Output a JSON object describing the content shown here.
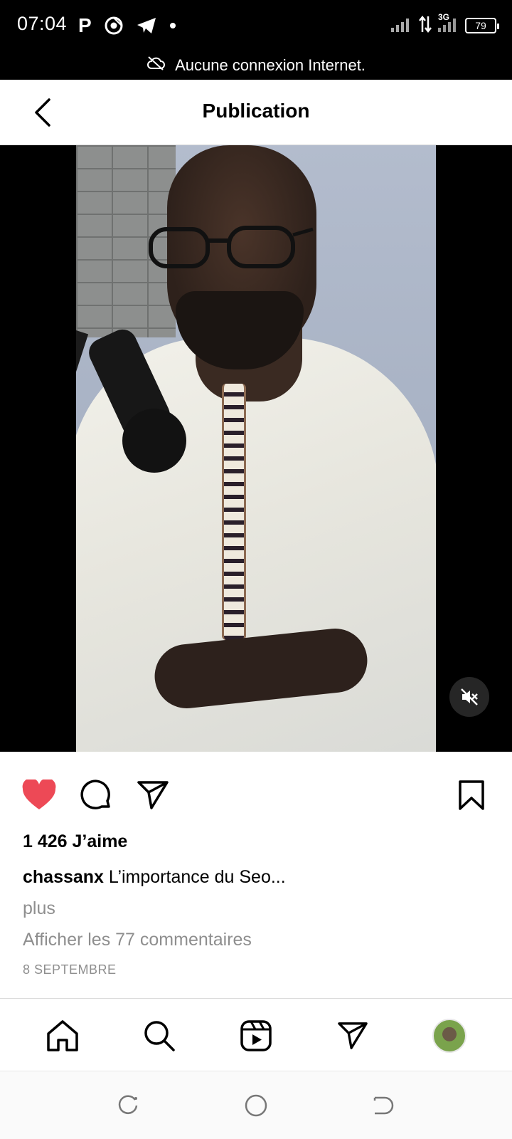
{
  "status_bar": {
    "time": "07:04",
    "left_icons": [
      "parking-icon",
      "chrome-icon",
      "telegram-icon",
      "notification-dot"
    ],
    "network": "3G",
    "battery": "79"
  },
  "offline_banner": {
    "text": "Aucune connexion Internet.",
    "icon": "cloud-off-icon"
  },
  "header": {
    "title": "Publication",
    "back_icon": "chevron-left-icon"
  },
  "media": {
    "muted": true,
    "mute_icon": "speaker-muted-icon"
  },
  "actions": {
    "liked": true,
    "like_color": "#ed4956",
    "icons": [
      "heart-icon",
      "comment-icon",
      "send-icon",
      "bookmark-icon"
    ]
  },
  "post": {
    "likes": "1 426 J’aime",
    "username": "chassanx",
    "caption": " L’importance du Seo...",
    "more": "plus",
    "comments": "Afficher les 77 commentaires",
    "date": "8 SEPTEMBRE"
  },
  "bottom_nav": {
    "items": [
      "home-icon",
      "search-icon",
      "reels-icon",
      "send-icon",
      "profile-avatar"
    ]
  },
  "system_nav": {
    "items": [
      "recents-icon",
      "home-circle-icon",
      "back-icon"
    ]
  }
}
